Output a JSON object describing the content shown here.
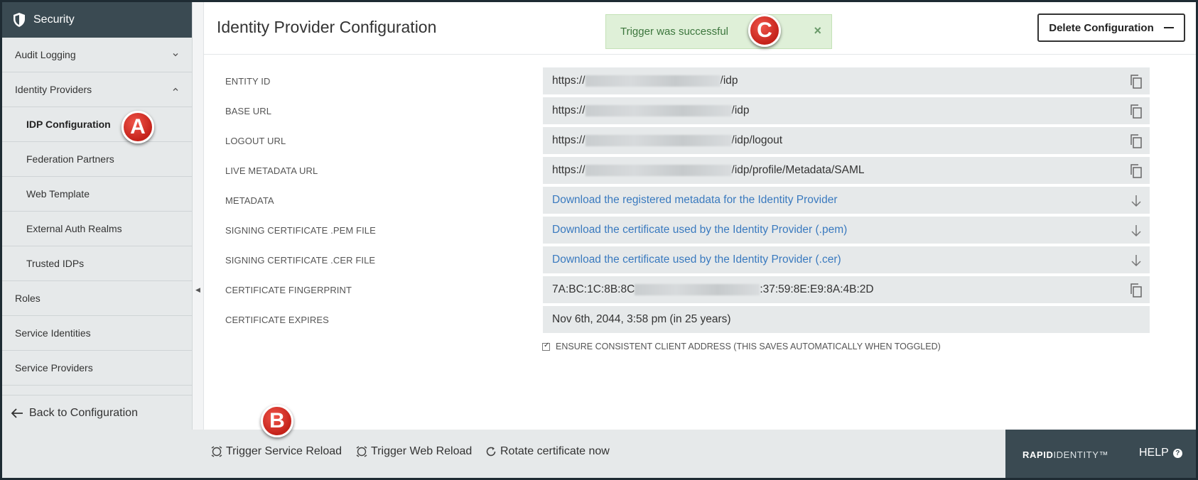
{
  "sidebar": {
    "title": "Security",
    "items": [
      {
        "label": "Audit Logging",
        "chevron": "down"
      },
      {
        "label": "Identity Providers",
        "chevron": "up"
      },
      {
        "label": "IDP Configuration",
        "sub": true,
        "active": true
      },
      {
        "label": "Federation Partners",
        "sub": true
      },
      {
        "label": "Web Template",
        "sub": true
      },
      {
        "label": "External Auth Realms",
        "sub": true
      },
      {
        "label": "Trusted IDPs",
        "sub": true
      },
      {
        "label": "Roles"
      },
      {
        "label": "Service Identities"
      },
      {
        "label": "Service Providers"
      }
    ],
    "back_label": "Back to Configuration"
  },
  "main": {
    "title": "Identity Provider Configuration",
    "toast": "Trigger was successful",
    "toast_close": "×",
    "delete_label": "Delete Configuration",
    "rows": [
      {
        "label": "ENTITY ID",
        "prefix": "https://",
        "suffix": "/idp",
        "action": "copy-icon"
      },
      {
        "label": "BASE URL",
        "prefix": "https://",
        "suffix": "/idp",
        "action": "copy-icon"
      },
      {
        "label": "LOGOUT URL",
        "prefix": "https://",
        "suffix": "/idp/logout",
        "action": "copy-icon"
      },
      {
        "label": "LIVE METADATA URL",
        "prefix": "https://",
        "suffix": "/idp/profile/Metadata/SAML",
        "action": "copy-icon"
      },
      {
        "label": "METADATA",
        "link": "Download the registered metadata for the Identity Provider",
        "action": "download-icon"
      },
      {
        "label": "SIGNING CERTIFICATE .PEM FILE",
        "link": "Download the certificate used by the Identity Provider (.pem)",
        "action": "download-icon"
      },
      {
        "label": "SIGNING CERTIFICATE .CER FILE",
        "link": "Download the certificate used by the Identity Provider (.cer)",
        "action": "download-icon"
      },
      {
        "label": "CERTIFICATE FINGERPRINT",
        "prefix": "7A:BC:1C:8B:8C",
        "suffix": ":37:59:8E:E9:8A:4B:2D",
        "action": "copy-icon"
      },
      {
        "label": "CERTIFICATE EXPIRES",
        "text": "Nov 6th, 2044, 3:58 pm (in 25 years)"
      }
    ],
    "ensure_label": "ENSURE CONSISTENT CLIENT ADDRESS (THIS SAVES AUTOMATICALLY WHEN TOGGLED)",
    "ensure_checked": true
  },
  "bottom": {
    "actions": [
      "Trigger Service Reload",
      "Trigger Web Reload",
      "Rotate certificate now"
    ],
    "brand_bold": "RAPID",
    "brand_light": "IDENTITY",
    "brand_tm": "™",
    "help": "HELP",
    "help_icon": "?"
  },
  "markers": {
    "a": "A",
    "b": "B",
    "c": "C"
  },
  "colors": {
    "sidebar_header": "#3a4a52",
    "link": "#3a7abf",
    "toast_bg": "#dff0d8",
    "marker": "#d0271e"
  }
}
